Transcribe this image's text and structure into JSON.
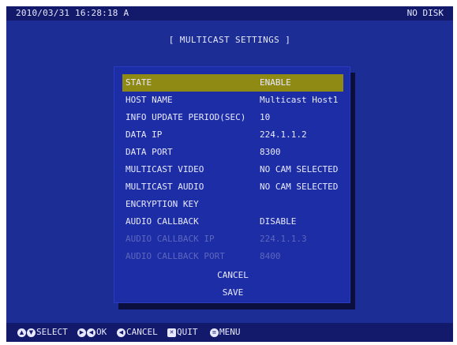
{
  "topbar": {
    "datetime": "2010/03/31 16:28:18  A",
    "disk_status": "NO DISK"
  },
  "title": "[ MULTICAST SETTINGS ]",
  "settings": [
    {
      "label": "STATE",
      "value": "ENABLE",
      "selected": true,
      "disabled": false
    },
    {
      "label": "HOST NAME",
      "value": "Multicast Host1",
      "selected": false,
      "disabled": false
    },
    {
      "label": "INFO UPDATE PERIOD(SEC)",
      "value": "10",
      "selected": false,
      "disabled": false
    },
    {
      "label": "DATA IP",
      "value": "224.1.1.2",
      "selected": false,
      "disabled": false
    },
    {
      "label": "DATA PORT",
      "value": "8300",
      "selected": false,
      "disabled": false
    },
    {
      "label": "MULTICAST VIDEO",
      "value": "NO CAM SELECTED",
      "selected": false,
      "disabled": false
    },
    {
      "label": "MULTICAST AUDIO",
      "value": "NO CAM SELECTED",
      "selected": false,
      "disabled": false
    },
    {
      "label": "ENCRYPTION KEY",
      "value": "",
      "selected": false,
      "disabled": false
    },
    {
      "label": "AUDIO CALLBACK",
      "value": "DISABLE",
      "selected": false,
      "disabled": false
    },
    {
      "label": "AUDIO CALLBACK IP",
      "value": "224.1.1.3",
      "selected": false,
      "disabled": true
    },
    {
      "label": "AUDIO CALLBACK PORT",
      "value": "8400",
      "selected": false,
      "disabled": true
    }
  ],
  "buttons": {
    "cancel": "CANCEL",
    "save": "SAVE"
  },
  "footer": {
    "select": "SELECT",
    "ok": "OK",
    "cancel": "CANCEL",
    "quit": "QUIT",
    "menu": "MENU"
  },
  "colors": {
    "background": "#1d2d96",
    "selected_row": "#8f8a14",
    "bar": "#13196b"
  }
}
